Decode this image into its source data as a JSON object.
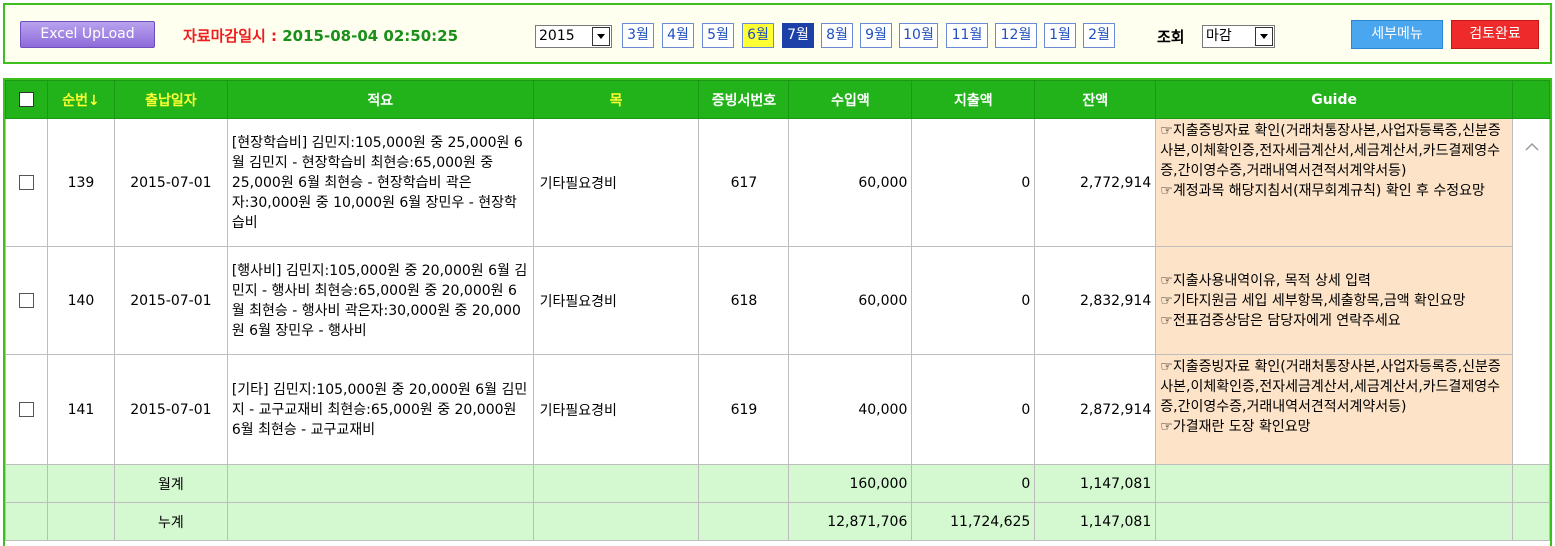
{
  "toolbar": {
    "excel_label": "Excel UpLoad",
    "close_label": "자료마감일시 : ",
    "close_datetime": "2015-08-04 02:50:25",
    "year": "2015",
    "months": [
      "3월",
      "4월",
      "5월",
      "6월",
      "7월",
      "8월",
      "9월",
      "10월",
      "11월",
      "12월",
      "1월",
      "2월"
    ],
    "highlight_month": "6월",
    "selected_month": "7월",
    "inquiry_label": "조회",
    "inquiry_value": "마감",
    "detail_menu": "세부메뉴",
    "review_done": "검토완료"
  },
  "columns": {
    "seq": "순번↓",
    "date": "출납일자",
    "desc": "적요",
    "item": "목",
    "voucher": "증빙서번호",
    "income": "수입액",
    "expense": "지출액",
    "balance": "잔액",
    "guide": "Guide"
  },
  "rows": [
    {
      "seq": "139",
      "date": "2015-07-01",
      "desc": "[현장학습비] 김민지:105,000원 중 25,000원 6월 김민지 - 현장학습비 최현승:65,000원 중 25,000원 6월 최현승 - 현장학습비 곽은자:30,000원 중 10,000원 6월 장민우 - 현장학습비",
      "item": "기타필요경비",
      "voucher": "617",
      "income": "60,000",
      "expense": "0",
      "balance": "2,772,914",
      "guide": [
        "☞지출증빙자료 확인(거래처통장사본,사업자등록증,신분증사본,이체확인증,전자세금계산서,세금계산서,카드결제영수증,간이영수증,거래내역서견적서계약서등)",
        "☞계정과목 해당지침서(재무회계규칙) 확인 후 수정요망"
      ]
    },
    {
      "seq": "140",
      "date": "2015-07-01",
      "desc": "[행사비] 김민지:105,000원 중 20,000원 6월 김민지 - 행사비 최현승:65,000원 중 20,000원 6월 최현승 - 행사비 곽은자:30,000원 중 20,000원 6월 장민우 - 행사비",
      "item": "기타필요경비",
      "voucher": "618",
      "income": "60,000",
      "expense": "0",
      "balance": "2,832,914",
      "guide": [
        "☞지출사용내역이유, 목적 상세 입력",
        "☞기타지원금 세입 세부항목,세출항목,금액 확인요망",
        "☞전표검증상담은 담당자에게 연락주세요"
      ]
    },
    {
      "seq": "141",
      "date": "2015-07-01",
      "desc": "[기타] 김민지:105,000원 중 20,000원 6월 김민지 - 교구교재비 최현승:65,000원 중 20,000원 6월 최현승 - 교구교재비",
      "item": "기타필요경비",
      "voucher": "619",
      "income": "40,000",
      "expense": "0",
      "balance": "2,872,914",
      "guide": [
        "☞지출증빙자료 확인(거래처통장사본,사업자등록증,신분증사본,이체확인증,전자세금계산서,세금계산서,카드결제영수증,간이영수증,거래내역서견적서계약서등)",
        "☞가결재란 도장 확인요망"
      ]
    }
  ],
  "monthly": {
    "label": "월계",
    "income": "160,000",
    "expense": "0",
    "balance": "1,147,081"
  },
  "cumulative": {
    "label": "누계",
    "income": "12,871,706",
    "expense": "11,724,625",
    "balance": "1,147,081"
  },
  "colors": {
    "header_green": "#22b21a",
    "guide_bg": "#fde3c8",
    "sum_bg": "#d4f8d0",
    "accent_red": "#ee1d1d"
  }
}
